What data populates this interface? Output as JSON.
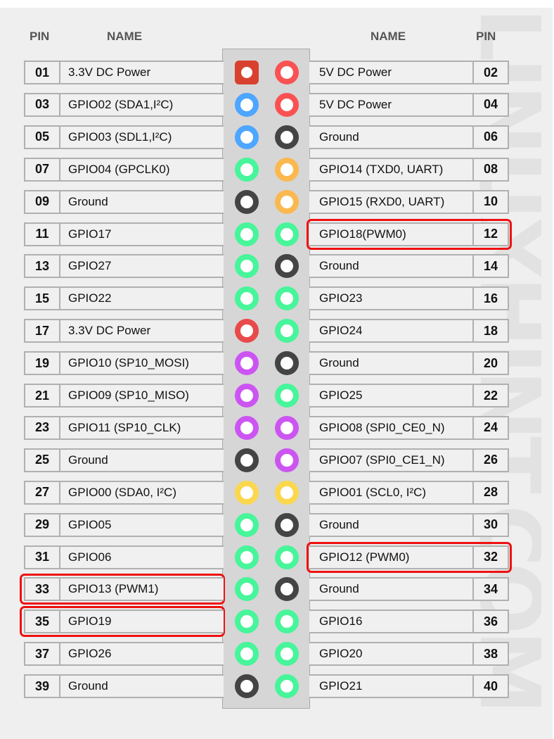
{
  "headers": {
    "left_pin": "PIN",
    "left_name": "NAME",
    "right_name": "NAME",
    "right_pin": "PIN"
  },
  "watermark": "LINUXHINT.COM",
  "colors": {
    "power_3v3": "#e84a4a",
    "power_3v3_square": "#d9412f",
    "power_5v": "#fa5252",
    "i2c": "#4da6ff",
    "ground": "#444444",
    "gpio": "#47f59a",
    "uart": "#fbb84f",
    "spi": "#cc55f2",
    "eeprom": "#fbd74e",
    "highlight": "#ee1111"
  },
  "rows": [
    {
      "left": {
        "pin": "01",
        "name": "3.3V DC Power",
        "type": "power_3v3_square",
        "highlight": false
      },
      "right": {
        "pin": "02",
        "name": "5V DC Power",
        "type": "power_5v",
        "highlight": false
      }
    },
    {
      "left": {
        "pin": "03",
        "name": "GPIO02 (SDA1,I²C)",
        "type": "i2c",
        "highlight": false
      },
      "right": {
        "pin": "04",
        "name": "5V DC Power",
        "type": "power_5v",
        "highlight": false
      }
    },
    {
      "left": {
        "pin": "05",
        "name": "GPIO03 (SDL1,I²C)",
        "type": "i2c",
        "highlight": false
      },
      "right": {
        "pin": "06",
        "name": "Ground",
        "type": "ground",
        "highlight": false
      }
    },
    {
      "left": {
        "pin": "07",
        "name": "GPIO04 (GPCLK0)",
        "type": "gpio",
        "highlight": false
      },
      "right": {
        "pin": "08",
        "name": "GPIO14 (TXD0, UART)",
        "type": "uart",
        "highlight": false
      }
    },
    {
      "left": {
        "pin": "09",
        "name": "Ground",
        "type": "ground",
        "highlight": false
      },
      "right": {
        "pin": "10",
        "name": "GPIO15 (RXD0, UART)",
        "type": "uart",
        "highlight": false
      }
    },
    {
      "left": {
        "pin": "11",
        "name": "GPIO17",
        "type": "gpio",
        "highlight": false
      },
      "right": {
        "pin": "12",
        "name": "GPIO18(PWM0)",
        "type": "gpio",
        "highlight": true
      }
    },
    {
      "left": {
        "pin": "13",
        "name": "GPIO27",
        "type": "gpio",
        "highlight": false
      },
      "right": {
        "pin": "14",
        "name": "Ground",
        "type": "ground",
        "highlight": false
      }
    },
    {
      "left": {
        "pin": "15",
        "name": "GPIO22",
        "type": "gpio",
        "highlight": false
      },
      "right": {
        "pin": "16",
        "name": "GPIO23",
        "type": "gpio",
        "highlight": false
      }
    },
    {
      "left": {
        "pin": "17",
        "name": "3.3V DC Power",
        "type": "power_3v3",
        "highlight": false
      },
      "right": {
        "pin": "18",
        "name": "GPIO24",
        "type": "gpio",
        "highlight": false
      }
    },
    {
      "left": {
        "pin": "19",
        "name": "GPIO10 (SP10_MOSI)",
        "type": "spi",
        "highlight": false
      },
      "right": {
        "pin": "20",
        "name": "Ground",
        "type": "ground",
        "highlight": false
      }
    },
    {
      "left": {
        "pin": "21",
        "name": "GPIO09 (SP10_MISO)",
        "type": "spi",
        "highlight": false
      },
      "right": {
        "pin": "22",
        "name": "GPIO25",
        "type": "gpio",
        "highlight": false
      }
    },
    {
      "left": {
        "pin": "23",
        "name": "GPIO11 (SP10_CLK)",
        "type": "spi",
        "highlight": false
      },
      "right": {
        "pin": "24",
        "name": "GPIO08 (SPI0_CE0_N)",
        "type": "spi",
        "highlight": false
      }
    },
    {
      "left": {
        "pin": "25",
        "name": "Ground",
        "type": "ground",
        "highlight": false
      },
      "right": {
        "pin": "26",
        "name": "GPIO07 (SPI0_CE1_N)",
        "type": "spi",
        "highlight": false
      }
    },
    {
      "left": {
        "pin": "27",
        "name": "GPIO00 (SDA0, I²C)",
        "type": "eeprom",
        "highlight": false
      },
      "right": {
        "pin": "28",
        "name": "GPIO01 (SCL0, I²C)",
        "type": "eeprom",
        "highlight": false
      }
    },
    {
      "left": {
        "pin": "29",
        "name": "GPIO05",
        "type": "gpio",
        "highlight": false
      },
      "right": {
        "pin": "30",
        "name": "Ground",
        "type": "ground",
        "highlight": false
      }
    },
    {
      "left": {
        "pin": "31",
        "name": "GPIO06",
        "type": "gpio",
        "highlight": false
      },
      "right": {
        "pin": "32",
        "name": "GPIO12 (PWM0)",
        "type": "gpio",
        "highlight": true
      }
    },
    {
      "left": {
        "pin": "33",
        "name": "GPIO13 (PWM1)",
        "type": "gpio",
        "highlight": true
      },
      "right": {
        "pin": "34",
        "name": "Ground",
        "type": "ground",
        "highlight": false
      }
    },
    {
      "left": {
        "pin": "35",
        "name": "GPIO19",
        "type": "gpio",
        "highlight": true
      },
      "right": {
        "pin": "36",
        "name": "GPIO16",
        "type": "gpio",
        "highlight": false
      }
    },
    {
      "left": {
        "pin": "37",
        "name": "GPIO26",
        "type": "gpio",
        "highlight": false
      },
      "right": {
        "pin": "38",
        "name": "GPIO20",
        "type": "gpio",
        "highlight": false
      }
    },
    {
      "left": {
        "pin": "39",
        "name": "Ground",
        "type": "ground",
        "highlight": false
      },
      "right": {
        "pin": "40",
        "name": "GPIO21",
        "type": "gpio",
        "highlight": false
      }
    }
  ]
}
